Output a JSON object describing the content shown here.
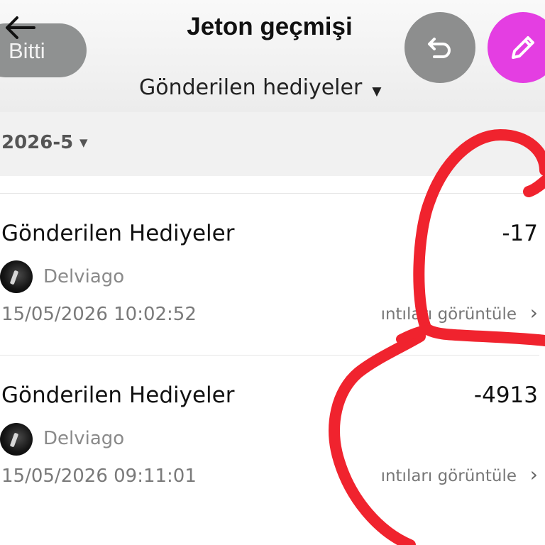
{
  "header": {
    "title": "Jeton geçmişi",
    "done_label": "Bitti",
    "filter_label": "Gönderilen hediyeler",
    "back_icon": "back-arrow-icon",
    "undo_icon": "undo-icon",
    "edit_icon": "pencil-icon"
  },
  "month": {
    "label": "2026-5"
  },
  "transactions": [
    {
      "title": "Gönderilen Hediyeler",
      "amount": "-17",
      "user": "Delviago",
      "datetime": "15/05/2026 10:02:52",
      "link_label": "ıntıları görüntüle"
    },
    {
      "title": "Gönderilen Hediyeler",
      "amount": "-4913",
      "user": "Delviago",
      "datetime": "15/05/2026 09:11:01",
      "link_label": "ıntıları görüntüle"
    }
  ],
  "colors": {
    "accent": "#e43ee2",
    "button_gray": "#8d8e8e",
    "annotation_red": "#f0232e"
  }
}
